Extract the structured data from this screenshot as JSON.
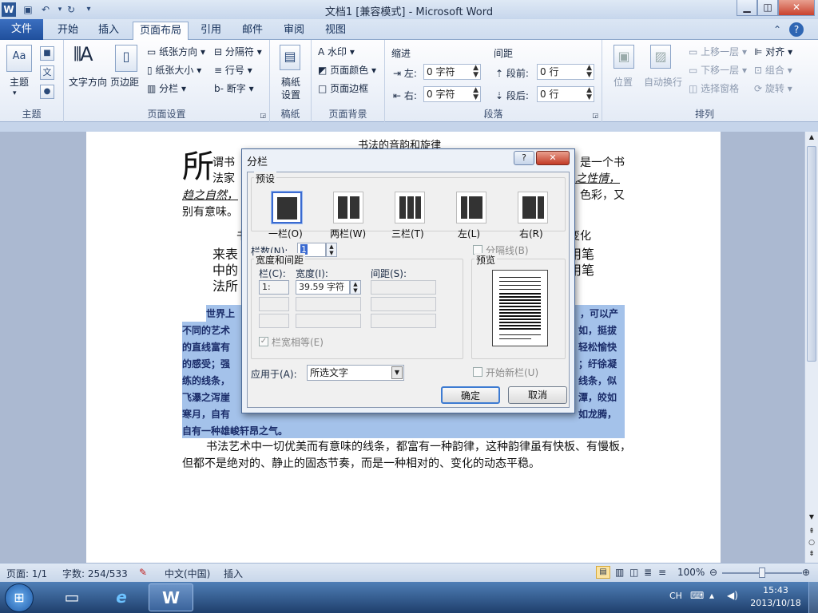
{
  "window": {
    "title": "文档1 [兼容模式] - Microsoft Word"
  },
  "tabs": [
    {
      "label": "文件"
    },
    {
      "label": "开始"
    },
    {
      "label": "插入"
    },
    {
      "label": "页面布局"
    },
    {
      "label": "引用"
    },
    {
      "label": "邮件"
    },
    {
      "label": "审阅"
    },
    {
      "label": "视图"
    }
  ],
  "ribbon": {
    "theme": {
      "group": "主题",
      "b1": "主题",
      "b2": "文",
      "b3": "Aa"
    },
    "pagesetup": {
      "group": "页面设置",
      "text_dir": "文字方向",
      "margins": "页边距",
      "orientation": "纸张方向",
      "size": "纸张大小",
      "columns": "分栏",
      "breaks": "分隔符",
      "line_numbers": "行号",
      "hyphenation": "断字"
    },
    "draft": {
      "group": "稿纸",
      "btn1": "稿纸",
      "btn2": "设置"
    },
    "background": {
      "group": "页面背景",
      "watermark": "水印",
      "page_color": "页面颜色",
      "page_border": "页面边框"
    },
    "paragraph": {
      "group": "段落",
      "indent": "缩进",
      "spacing": "间距",
      "left": "左:",
      "right": "右:",
      "before": "段前:",
      "after": "段后:",
      "left_val": "0 字符",
      "right_val": "0 字符",
      "before_val": "0 行",
      "after_val": "0 行"
    },
    "arrange": {
      "group": "排列",
      "position": "位置",
      "wrap": "自动换行",
      "forward": "上移一层",
      "backward": "下移一层",
      "pane": "选择窗格",
      "align": "对齐",
      "group_btn": "组合",
      "rotate": "旋转"
    }
  },
  "document": {
    "heading": "书法的音韵和旋律",
    "drop_cap": "所",
    "p1a": "谓书",
    "p1a_right": "是一个书",
    "p1b": "法家",
    "p1b_right": "之性情，",
    "p1c": "趋之自然，",
    "p1c_right": "色彩，又",
    "p1d": "别有意味。",
    "p2a": "书",
    "p2a_right": "变化",
    "p2b": "来表",
    "p2b_right": "用笔",
    "p2c": "中的",
    "p2c_right": "用笔",
    "p2d": "法所",
    "s1": "世界上",
    "s1r": "，可以产",
    "s2": "不同的艺术",
    "s2r": "如，挺拔",
    "s3": "的直线富有",
    "s3r": "轻松愉快",
    "s4": "的感受；强",
    "s4r": "；纡徐凝",
    "s5": "练的线条，",
    "s5r": "线条，似",
    "s6": "飞瀑之泻崖",
    "s6r": "潭，皎如",
    "s7": "寒月，自有",
    "s7r": "如龙腾，",
    "s8": "自有一种雄峻轩昂之气。",
    "p4a": "书法艺术中一切优美而有意味的线条，都富有一种韵律，这种韵律虽有快板、有慢板，",
    "p4b": "但都不是绝对的、静止的固态节奏，而是一种相对的、变化的动态平稳。"
  },
  "dialog": {
    "title": "分栏",
    "help": "?",
    "presets_label": "预设",
    "presets": [
      {
        "label": "一栏(O)"
      },
      {
        "label": "两栏(W)"
      },
      {
        "label": "三栏(T)"
      },
      {
        "label": "左(L)"
      },
      {
        "label": "右(R)"
      }
    ],
    "num_cols_label": "栏数(N):",
    "num_cols": "1",
    "separator_label": "分隔线(B)",
    "width_spacing_label": "宽度和间距",
    "col_header": "栏(C):",
    "width_header": "宽度(I):",
    "spacing_header": "间距(S):",
    "row1_col": "1:",
    "row1_width": "39.59 字符",
    "equal_width_label": "栏宽相等(E)",
    "preview_label": "预览",
    "apply_label": "应用于(A):",
    "apply_value": "所选文字",
    "new_col_label": "开始新栏(U)",
    "ok": "确定",
    "cancel": "取消"
  },
  "status": {
    "page": "页面: 1/1",
    "words": "字数: 254/533",
    "lang": "中文(中国)",
    "mode": "插入",
    "zoom": "100%"
  },
  "taskbar": {
    "ime": "CH",
    "time": "15:43",
    "date": "2013/10/18"
  }
}
